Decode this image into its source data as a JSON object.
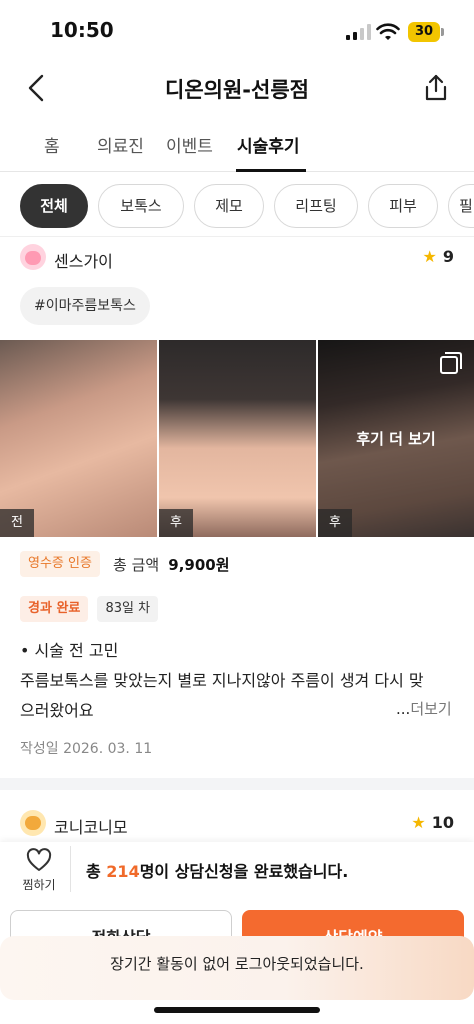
{
  "status_bar": {
    "time": "10:50",
    "battery": "30"
  },
  "header": {
    "title": "디온의원-선릉점"
  },
  "tabs": [
    {
      "label": "홈"
    },
    {
      "label": "의료진"
    },
    {
      "label": "이벤트"
    },
    {
      "label": "시술후기",
      "active": true
    }
  ],
  "filters": [
    "전체",
    "보톡스",
    "제모",
    "리프팅",
    "피부",
    "필"
  ],
  "review1": {
    "reviewer": "센스가이",
    "rating": "9",
    "hashtag": "이마주름보톡스",
    "photos": [
      {
        "tag": "전"
      },
      {
        "tag": "후"
      },
      {
        "tag": "후",
        "overlay_text": "후기 더 보기"
      }
    ],
    "receipt_badge": "영수증 인증",
    "amount_label": "총 금액",
    "amount_value": "9,900원",
    "status_badge": "경과 완료",
    "days_badge": "83일 차",
    "body_line1": "• 시술 전 고민",
    "body_line2": "주름보톡스를 맞았는지 별로 지나지않아 주름이 생겨 다시 맞",
    "body_line3": "으러왔어요",
    "read_more_dots": "...",
    "read_more": "더보기",
    "date": "작성일 2026. 03. 11"
  },
  "review2": {
    "reviewer": "코니코니모",
    "rating": "10"
  },
  "bottom_bar": {
    "like_label": "찜하기",
    "consult_prefix": "총 ",
    "consult_count": "214",
    "consult_suffix": "명이 상담신청을 완료했습니다.",
    "btn_left": "전화상담",
    "btn_right": "상담예약"
  },
  "toast": "장기간 활동이 없어 로그아웃되었습니다.",
  "colors": {
    "accent": "#f46a2f",
    "star": "#f5b700",
    "chip_active": "#333333"
  }
}
